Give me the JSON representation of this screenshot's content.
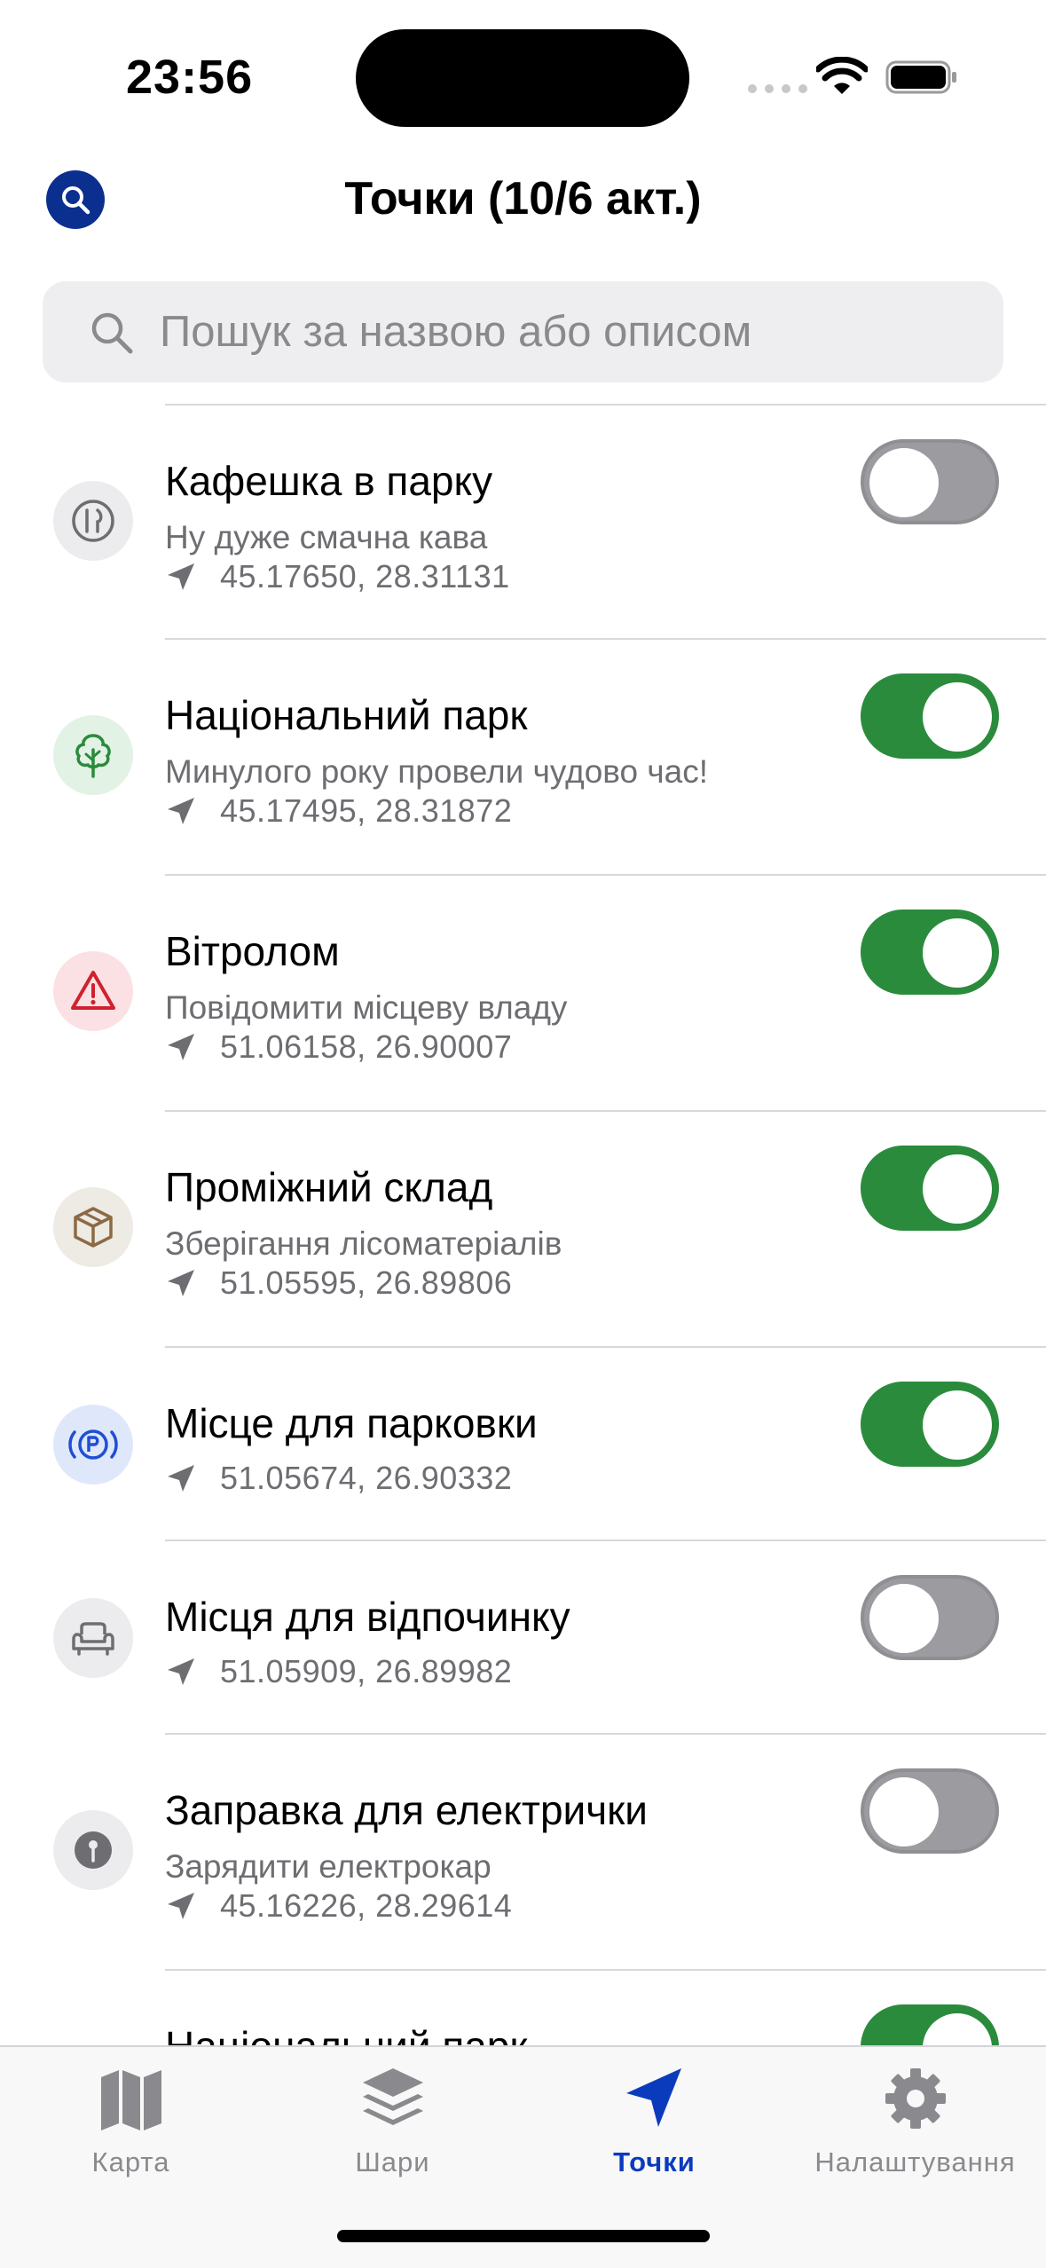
{
  "status_bar": {
    "time": "23:56"
  },
  "header": {
    "title": "Точки (10/6 акт.)",
    "search_icon": "search-icon"
  },
  "search": {
    "placeholder": "Пошук за назвою або описом",
    "value": ""
  },
  "points": [
    {
      "name": "Кафешка в парку",
      "description": "Ну дуже смачна кава",
      "coords": "45.17650, 28.31131",
      "icon": "fork-knife-icon",
      "enabled": false,
      "icon_bg": "#ececee",
      "icon_color": "#6d6d72"
    },
    {
      "name": "Національний парк",
      "description": "Минулого року провели чудово час!",
      "coords": "45.17495, 28.31872",
      "icon": "tree-icon",
      "enabled": true,
      "icon_bg": "#e2f2e5",
      "icon_color": "#2a8b3c"
    },
    {
      "name": "Вітролом",
      "description": "Повідомити місцеву владу",
      "coords": "51.06158, 26.90007",
      "icon": "warning-icon",
      "enabled": true,
      "icon_bg": "#fbe1e3",
      "icon_color": "#d0202e"
    },
    {
      "name": "Проміжний склад",
      "description": "Зберігання лісоматеріалів",
      "coords": "51.05595, 26.89806",
      "icon": "box-icon",
      "enabled": true,
      "icon_bg": "#eeeae4",
      "icon_color": "#8b6a45"
    },
    {
      "name": "Місце для парковки",
      "description": "",
      "coords": "51.05674, 26.90332",
      "icon": "parking-icon",
      "enabled": true,
      "icon_bg": "#dfe7fb",
      "icon_color": "#1f4fd1"
    },
    {
      "name": "Місця для відпочинку",
      "description": "",
      "coords": "51.05909, 26.89982",
      "icon": "armchair-icon",
      "enabled": false,
      "icon_bg": "#ececee",
      "icon_color": "#6d6d72"
    },
    {
      "name": "Заправка для електрички",
      "description": "Зарядити електрокар",
      "coords": "45.16226, 28.29614",
      "icon": "pin-icon",
      "enabled": false,
      "icon_bg": "#ececee",
      "icon_color": "#6d6d72"
    },
    {
      "name": "Національний парк",
      "description": "",
      "coords": "",
      "icon": "tree-icon",
      "enabled": true,
      "icon_bg": "#e2f2e5",
      "icon_color": "#2a8b3c"
    }
  ],
  "tabs": [
    {
      "label": "Карта",
      "icon": "map-icon",
      "active": false
    },
    {
      "label": "Шари",
      "icon": "layers-icon",
      "active": false
    },
    {
      "label": "Точки",
      "icon": "location-arrow-icon",
      "active": true
    },
    {
      "label": "Налаштування",
      "icon": "gear-icon",
      "active": false
    }
  ],
  "colors": {
    "accent": "#0b3bbd",
    "toggle_on": "#2a8b3c",
    "toggle_off": "#9b9ba0"
  }
}
